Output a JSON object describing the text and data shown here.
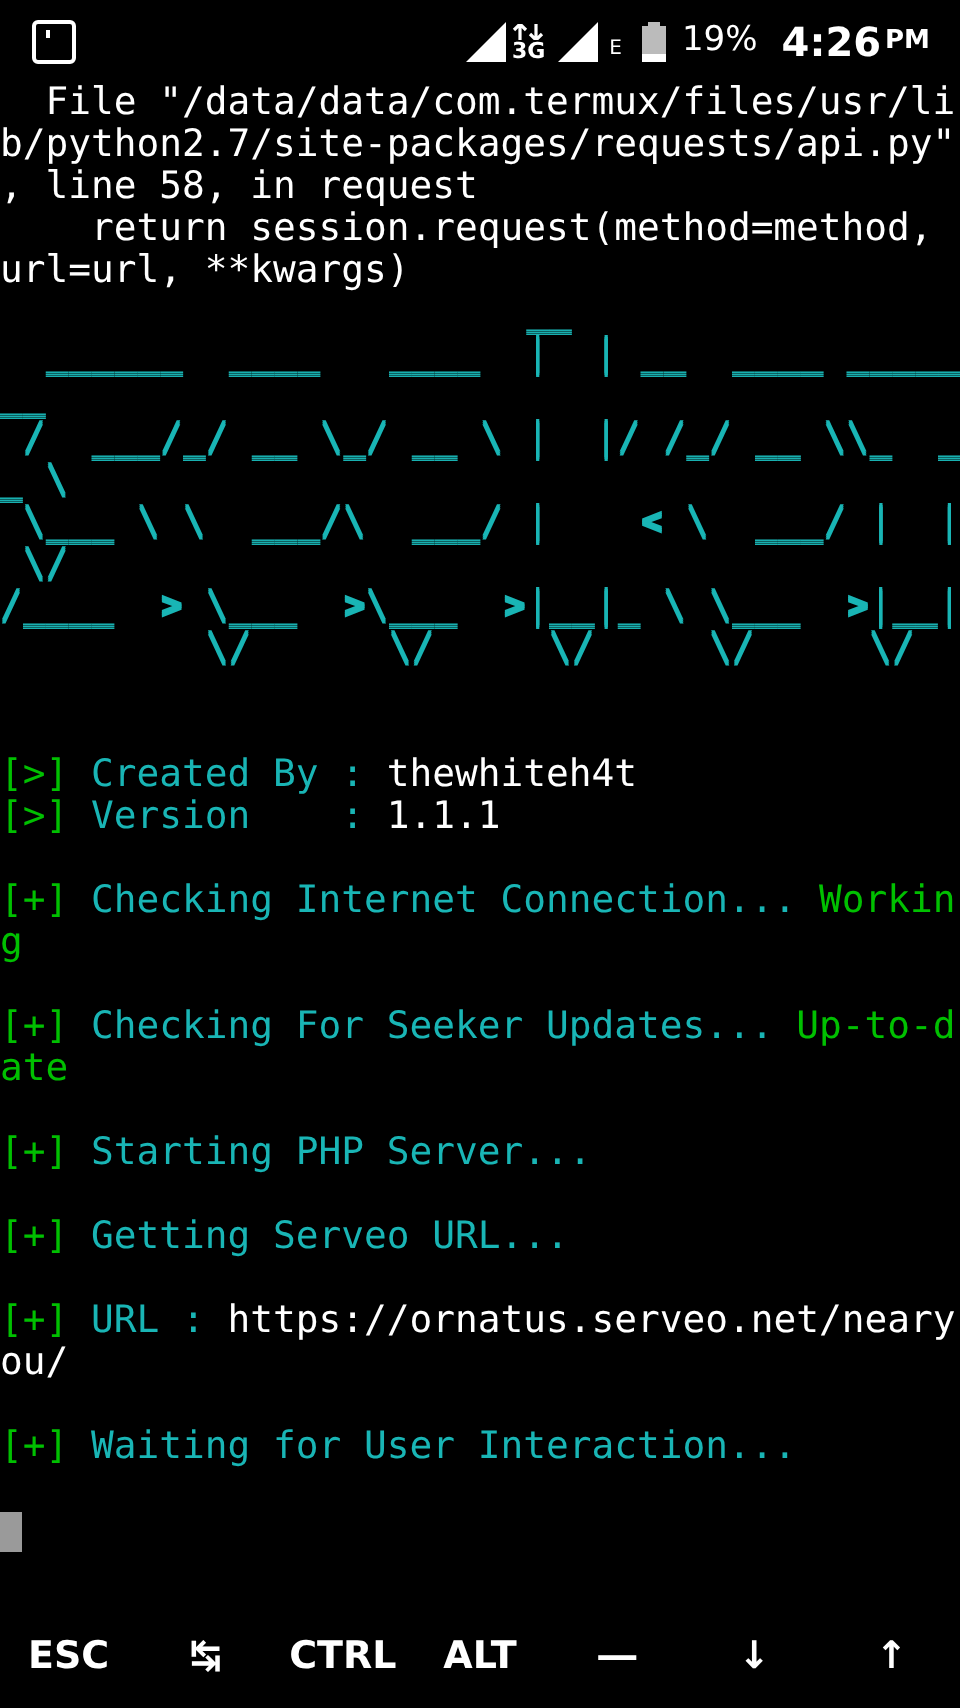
{
  "status_bar": {
    "network_type": "3G",
    "second_network_type": "E",
    "battery": "19%",
    "time": "4:26",
    "ampm": "PM"
  },
  "terminal_lines": [
    {
      "kind": "text",
      "segments": [
        {
          "text": "  File \"/data/data/com.termux/files/usr/li",
          "color": "#ffffff"
        }
      ]
    },
    {
      "kind": "text",
      "segments": [
        {
          "text": "b/python2.7/site-packages/requests/api.py\"",
          "color": "#ffffff"
        }
      ]
    },
    {
      "kind": "text",
      "segments": [
        {
          "text": ", line 58, in request",
          "color": "#ffffff"
        }
      ]
    },
    {
      "kind": "text",
      "segments": [
        {
          "text": "    return session.request(method=method,",
          "color": "#ffffff"
        }
      ]
    },
    {
      "kind": "text",
      "segments": [
        {
          "text": "url=url, **kwargs)",
          "color": "#ffffff"
        }
      ]
    },
    {
      "kind": "art",
      "text": "                       __",
      "color": "#19b5b5"
    },
    {
      "kind": "art",
      "text": "  ______  ____   ____  |  | __  ____ _____",
      "color": "#19b5b5"
    },
    {
      "kind": "art",
      "text": "__",
      "color": "#19b5b5"
    },
    {
      "kind": "art",
      "text": " /  ___/_/ __ \\_/ __ \\ |  |/ /_/ __ \\\\_  _",
      "color": "#19b5b5"
    },
    {
      "kind": "art",
      "text": "_ \\",
      "color": "#19b5b5"
    },
    {
      "kind": "art",
      "text": " \\___ \\ \\  ___/\\  ___/ |    < \\  ___/ |  |",
      "color": "#19b5b5"
    },
    {
      "kind": "art",
      "text": " \\/",
      "color": "#19b5b5"
    },
    {
      "kind": "art",
      "text": "/____  > \\___  >\\___  >|__|_ \\ \\___  >|__|",
      "color": "#19b5b5"
    },
    {
      "kind": "art",
      "text": "         \\/      \\/     \\/     \\/     \\/",
      "color": "#19b5b5"
    },
    {
      "kind": "blank"
    },
    {
      "kind": "blank"
    },
    {
      "kind": "text",
      "segments": [
        {
          "text": "[>]",
          "color": "#00c000"
        },
        {
          "text": " Created By : ",
          "color": "#19b5b5"
        },
        {
          "text": "thewhiteh4t",
          "color": "#ffffff"
        }
      ]
    },
    {
      "kind": "text",
      "segments": [
        {
          "text": "[>]",
          "color": "#00c000"
        },
        {
          "text": " Version    : ",
          "color": "#19b5b5"
        },
        {
          "text": "1.1.1",
          "color": "#ffffff"
        }
      ]
    },
    {
      "kind": "blank"
    },
    {
      "kind": "text",
      "segments": [
        {
          "text": "[+]",
          "color": "#00c000"
        },
        {
          "text": " Checking Internet Connection... ",
          "color": "#19b5b5"
        },
        {
          "text": "Workin",
          "color": "#00c000"
        }
      ]
    },
    {
      "kind": "text",
      "segments": [
        {
          "text": "g",
          "color": "#00c000"
        }
      ]
    },
    {
      "kind": "blank"
    },
    {
      "kind": "text",
      "segments": [
        {
          "text": "[+]",
          "color": "#00c000"
        },
        {
          "text": " Checking For Seeker Updates... ",
          "color": "#19b5b5"
        },
        {
          "text": "Up-to-d",
          "color": "#00c000"
        }
      ]
    },
    {
      "kind": "text",
      "segments": [
        {
          "text": "ate",
          "color": "#00c000"
        }
      ]
    },
    {
      "kind": "blank"
    },
    {
      "kind": "text",
      "segments": [
        {
          "text": "[+]",
          "color": "#00c000"
        },
        {
          "text": " Starting PHP Server...",
          "color": "#19b5b5"
        }
      ]
    },
    {
      "kind": "blank"
    },
    {
      "kind": "text",
      "segments": [
        {
          "text": "[+]",
          "color": "#00c000"
        },
        {
          "text": " Getting Serveo URL...",
          "color": "#19b5b5"
        }
      ]
    },
    {
      "kind": "blank"
    },
    {
      "kind": "text",
      "segments": [
        {
          "text": "[+]",
          "color": "#00c000"
        },
        {
          "text": " URL : ",
          "color": "#19b5b5"
        },
        {
          "text": "https://ornatus.serveo.net/neary",
          "color": "#ffffff"
        }
      ]
    },
    {
      "kind": "text",
      "segments": [
        {
          "text": "ou/",
          "color": "#ffffff"
        }
      ]
    },
    {
      "kind": "blank"
    },
    {
      "kind": "text",
      "segments": [
        {
          "text": "[+]",
          "color": "#00c000"
        },
        {
          "text": " Waiting for User Interaction...",
          "color": "#19b5b5"
        }
      ]
    },
    {
      "kind": "blank"
    },
    {
      "kind": "cursor"
    }
  ],
  "extra_keys": [
    "ESC",
    "↹",
    "CTRL",
    "ALT",
    "―",
    "↓",
    "↑"
  ]
}
